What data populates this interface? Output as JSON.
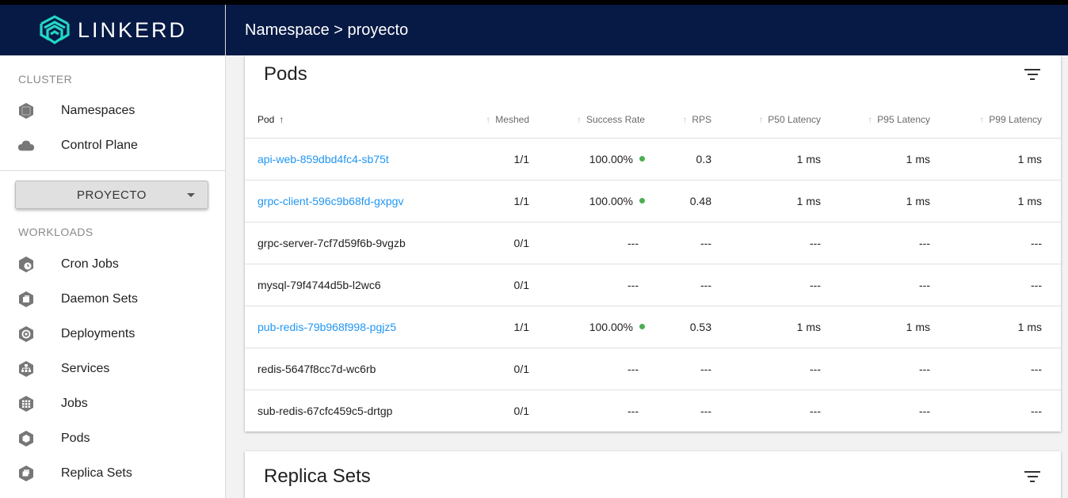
{
  "brand": {
    "name": "LINKERD"
  },
  "header": {
    "breadcrumb": "Namespace > proyecto"
  },
  "sidebar": {
    "cluster_label": "CLUSTER",
    "cluster_items": [
      {
        "label": "Namespaces",
        "icon": "namespaces-icon"
      },
      {
        "label": "Control Plane",
        "icon": "cloud-icon"
      }
    ],
    "namespace_select": {
      "value": "PROYECTO"
    },
    "workloads_label": "WORKLOADS",
    "workload_items": [
      {
        "label": "Cron Jobs",
        "icon": "cron-jobs-icon"
      },
      {
        "label": "Daemon Sets",
        "icon": "daemon-sets-icon"
      },
      {
        "label": "Deployments",
        "icon": "deployments-icon"
      },
      {
        "label": "Services",
        "icon": "services-icon"
      },
      {
        "label": "Jobs",
        "icon": "jobs-icon"
      },
      {
        "label": "Pods",
        "icon": "pods-icon"
      },
      {
        "label": "Replica Sets",
        "icon": "replica-sets-icon"
      }
    ]
  },
  "pods": {
    "title": "Pods",
    "columns": [
      "Pod",
      "Meshed",
      "Success Rate",
      "RPS",
      "P50 Latency",
      "P95 Latency",
      "P99 Latency"
    ],
    "rows": [
      {
        "pod": "api-web-859dbd4fc4-sb75t",
        "link": true,
        "meshed": "1/1",
        "success_rate": "100.00%",
        "rps": "0.3",
        "p50": "1 ms",
        "p95": "1 ms",
        "p99": "1 ms"
      },
      {
        "pod": "grpc-client-596c9b68fd-gxpgv",
        "link": true,
        "meshed": "1/1",
        "success_rate": "100.00%",
        "rps": "0.48",
        "p50": "1 ms",
        "p95": "1 ms",
        "p99": "1 ms"
      },
      {
        "pod": "grpc-server-7cf7d59f6b-9vgzb",
        "link": false,
        "meshed": "0/1",
        "success_rate": "---",
        "rps": "---",
        "p50": "---",
        "p95": "---",
        "p99": "---"
      },
      {
        "pod": "mysql-79f4744d5b-l2wc6",
        "link": false,
        "meshed": "0/1",
        "success_rate": "---",
        "rps": "---",
        "p50": "---",
        "p95": "---",
        "p99": "---"
      },
      {
        "pod": "pub-redis-79b968f998-pgjz5",
        "link": true,
        "meshed": "1/1",
        "success_rate": "100.00%",
        "rps": "0.53",
        "p50": "1 ms",
        "p95": "1 ms",
        "p99": "1 ms"
      },
      {
        "pod": "redis-5647f8cc7d-wc6rb",
        "link": false,
        "meshed": "0/1",
        "success_rate": "---",
        "rps": "---",
        "p50": "---",
        "p95": "---",
        "p99": "---"
      },
      {
        "pod": "sub-redis-67cfc459c5-drtgp",
        "link": false,
        "meshed": "0/1",
        "success_rate": "---",
        "rps": "---",
        "p50": "---",
        "p95": "---",
        "p99": "---"
      }
    ]
  },
  "replica_sets": {
    "title": "Replica Sets"
  },
  "colors": {
    "nav_bg": "#071a45",
    "link": "#2196f3",
    "success_dot": "#4caf50"
  }
}
